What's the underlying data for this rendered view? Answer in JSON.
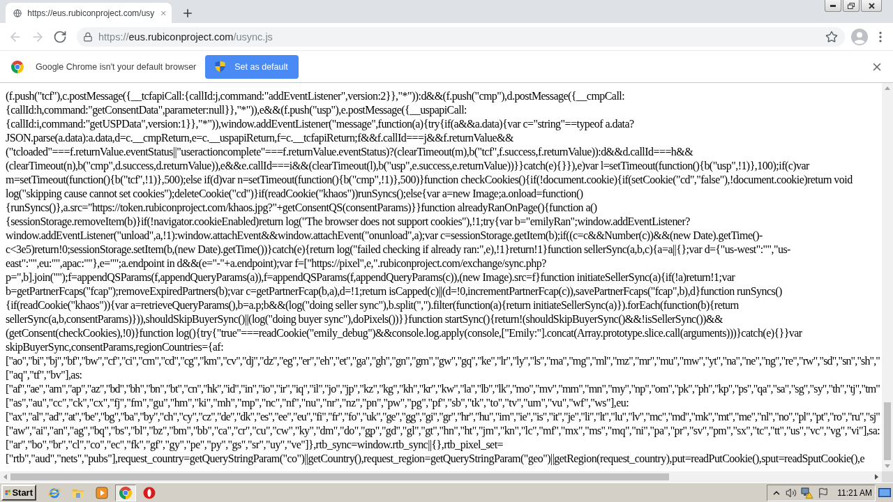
{
  "tabs": [
    {
      "title": "https://eus.rubiconproject.com/usy",
      "selected": true
    }
  ],
  "toolbar": {
    "nav": [
      {
        "kind": "back",
        "disabled": true
      },
      {
        "kind": "forward",
        "disabled": true
      },
      {
        "kind": "reload",
        "disabled": false
      }
    ],
    "url": {
      "scheme": "https://",
      "host": "eus.rubiconproject.com",
      "path": "/usync.js"
    }
  },
  "infobar": {
    "message": "Google Chrome isn't your default browser",
    "button": "Set as default"
  },
  "page": {
    "lines": [
      "(f.push(\"tcf\"),c.postMessage({__tcfapiCall:{callId:j,command:\"addEventListener\",version:2}},\"*\")):d&&(f.push(\"cmp\"),d.postMessage({__cmpCall:",
      "{callId:h,command:\"getConsentData\",parameter:null}},\"*\")),e&&(f.push(\"usp\"),e.postMessage({__uspapiCall:",
      "{callId:i,command:\"getUSPData\",version:1}},\"*\")),window.addEventListener(\"message\",function(a){try{if(a&&a.data){var c=\"string\"==typeof a.data?",
      "JSON.parse(a.data):a.data,d=c.__cmpReturn,e=c.__uspapiReturn,f=c.__tcfapiReturn;f&&f.callId===j&&f.returnValue&&",
      "(\"tcloaded\"===f.returnValue.eventStatus||\"useractioncomplete\"===f.returnValue.eventStatus)?(clearTimeout(m),b(\"tcf\",f.success,f.returnValue)):d&&d.callId===h&&",
      "(clearTimeout(n),b(\"cmp\",d.success,d.returnValue)),e&&e.callId===i&&(clearTimeout(l),b(\"usp\",e.success,e.returnValue))}}catch(e){}}),e)var l=setTimeout(function(){b(\"usp\",!1)},100);if(c)var",
      "m=setTimeout(function(){b(\"tcf\",!1)},500);else if(d)var n=setTimeout(function(){b(\"cmp\",!1)},500)}function checkCookies(){if(!document.cookie){if(setCookie(\"cd\",\"false\"),!document.cookie)return void",
      "log(\"skipping cause cannot set cookies\");deleteCookie(\"cd\")}if(readCookie(\"khaos\"))runSyncs();else{var a=new Image;a.onload=function()",
      "{runSyncs()},a.src=\"https://token.rubiconproject.com/khaos.jpg?\"+getConsentQS(consentParams)}}function alreadyRanOnPage(){function a()",
      "{sessionStorage.removeItem(b)}if(!navigator.cookieEnabled)return log(\"The browser does not support cookies\"),!1;try{var b=\"emilyRan\";window.addEventListener?",
      "window.addEventListener(\"unload\",a,!1):window.attachEvent&&window.attachEvent(\"onunload\",a);var c=sessionStorage.getItem(b);if((c=c&&Number(c))&&(new Date).getTime()-",
      "c<3e5)return!0;sessionStorage.setItem(b,(new Date).getTime())}catch(e){return log(\"failed checking if already ran:\",e),!1}return!1}function sellerSync(a,b,c){a=a||{};var d={\"us-west\":\"\",\"us-",
      "east\":\"\",eu:\"\",apac:\"\"},e=\"\";a.endpoint in d&&(e=\"-\"+a.endpoint);var f=[\"https://pixel\",e,\".rubiconproject.com/exchange/sync.php?",
      "p=\",b].join(\"\");f=appendQSParams(f,appendQueryParams(a)),f=appendQSParams(f,appendQueryParams(c)),(new Image).src=f}function initiateSellerSync(a){if(!a)return!1;var",
      "b=getPartnerFcaps(\"fcap\");removeExpiredPartners(b);var c=getPartnerFcap(b,a),d=!1;return isCapped(c)||(d=!0,incrementPartnerFcap(c)),savePartnerFcaps(\"fcap\",b),d}function runSyncs()",
      "{if(readCookie(\"khaos\")){var a=retrieveQueryParams(),b=a.p;b&&(log(\"doing seller sync\"),b.split(\",\").filter(function(a){return initiateSellerSync(a)}).forEach(function(b){return",
      "sellerSync(a,b,consentParams)})),shouldSkipBuyerSync()||(log(\"doing buyer sync\"),doPixels())}}function startSync(){return!(shouldSkipBuyerSync()&&!isSellerSync())&&",
      "(getConsent(checkCookies),!0)}function log(){try{\"true\"===readCookie(\"emily_debug\")&&console.log.apply(console,[\"Emily:\"].concat(Array.prototype.slice.call(arguments)))}catch(e){}}var",
      "skipBuyerSync,consentParams,regionCountries={af:",
      "[\"ao\",\"bi\",\"bj\",\"bf\",\"bw\",\"cf\",\"ci\",\"cm\",\"cd\",\"cg\",\"km\",\"cv\",\"dj\",\"dz\",\"eg\",\"er\",\"eh\",\"et\",\"ga\",\"gh\",\"gn\",\"gm\",\"gw\",\"gq\",\"ke\",\"lr\",\"ly\",\"ls\",\"ma\",\"mg\",\"ml\",\"mz\",\"mr\",\"mu\",\"mw\",\"yt\",\"na\",\"ne\",\"ng\",\"re\",\"rw\",\"sd\",\"sn\",\"sh\",\"",
      "[\"aq\",\"tf\",\"bv\"],as:",
      "[\"af\",\"ae\",\"am\",\"ap\",\"az\",\"bd\",\"bh\",\"bn\",\"bt\",\"cn\",\"hk\",\"id\",\"in\",\"io\",\"ir\",\"iq\",\"il\",\"jo\",\"jp\",\"kz\",\"kg\",\"kh\",\"kr\",\"kw\",\"la\",\"lb\",\"lk\",\"mo\",\"mv\",\"mm\",\"mn\",\"my\",\"np\",\"om\",\"pk\",\"ph\",\"kp\",\"ps\",\"qa\",\"sa\",\"sg\",\"sy\",\"th\",\"tj\",\"tm\"",
      "[\"as\",\"au\",\"cc\",\"ck\",\"cx\",\"fj\",\"fm\",\"gu\",\"hm\",\"ki\",\"mh\",\"mp\",\"nc\",\"nf\",\"nu\",\"nr\",\"nz\",\"pn\",\"pw\",\"pg\",\"pf\",\"sb\",\"tk\",\"to\",\"tv\",\"um\",\"vu\",\"wf\",\"ws\"],eu:",
      "[\"ax\",\"al\",\"ad\",\"at\",\"be\",\"bg\",\"ba\",\"by\",\"ch\",\"cy\",\"cz\",\"de\",\"dk\",\"es\",\"ee\",\"eu\",\"fi\",\"fr\",\"fo\",\"uk\",\"ge\",\"gg\",\"gi\",\"gr\",\"hr\",\"hu\",\"im\",\"ie\",\"is\",\"it\",\"je\",\"li\",\"lt\",\"lu\",\"lv\",\"mc\",\"md\",\"mk\",\"mt\",\"me\",\"nl\",\"no\",\"pl\",\"pt\",\"ro\",\"ru\",\"sj\"",
      "[\"aw\",\"ai\",\"an\",\"ag\",\"bq\",\"bs\",\"bl\",\"bz\",\"bm\",\"bb\",\"ca\",\"cr\",\"cu\",\"cw\",\"ky\",\"dm\",\"do\",\"gp\",\"gd\",\"gl\",\"gt\",\"hn\",\"ht\",\"jm\",\"kn\",\"lc\",\"mf\",\"mx\",\"ms\",\"mq\",\"ni\",\"pa\",\"pr\",\"sv\",\"pm\",\"sx\",\"tc\",\"tt\",\"us\",\"vc\",\"vg\",\"vi\"],sa:",
      "[\"ar\",\"bo\",\"br\",\"cl\",\"co\",\"ec\",\"fk\",\"gf\",\"gy\",\"pe\",\"py\",\"gs\",\"sr\",\"uy\",\"ve\"]},rtb_sync=window.rtb_sync||{},rtb_pixel_set=",
      "[\"rtb\",\"aud\",\"nets\",\"pubs\"],request_country=getQueryStringParam(\"co\")||getCountry(),request_region=getQueryStringParam(\"geo\")||getRegion(request_country),put=readPutCookie(),sput=readSputCookie(),e"
    ]
  },
  "taskbar": {
    "start": "Start",
    "apps": [
      {
        "kind": "e-logo",
        "selected": false
      },
      {
        "kind": "folder",
        "selected": false
      },
      {
        "kind": "play",
        "selected": false
      },
      {
        "kind": "ring-logo",
        "selected": true
      },
      {
        "kind": "oval-logo",
        "selected": false
      }
    ],
    "clock": "11:21 AM"
  }
}
